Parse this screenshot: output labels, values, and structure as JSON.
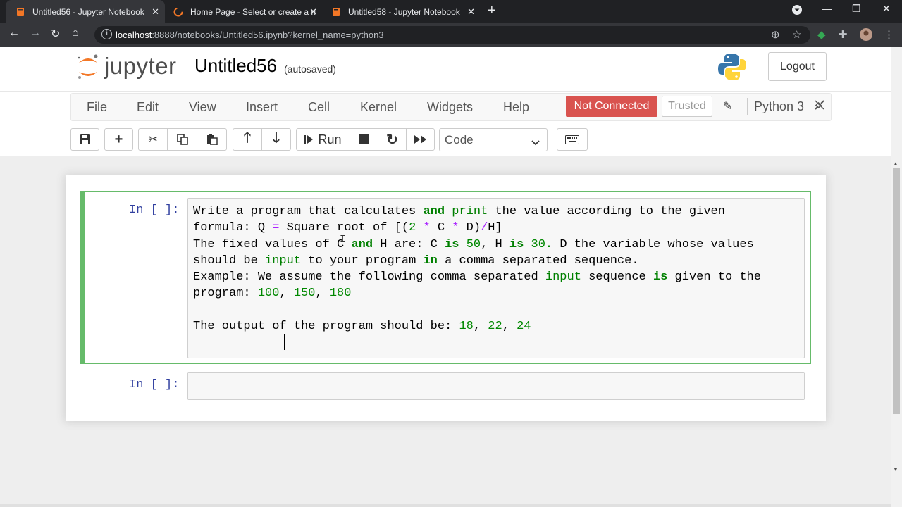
{
  "browser": {
    "tabs": [
      {
        "title": "Untitled56 - Jupyter Notebook",
        "active": true
      },
      {
        "title": "Home Page - Select or create a n",
        "active": false
      },
      {
        "title": "Untitled58 - Jupyter Notebook",
        "active": false
      }
    ],
    "url_host": "localhost",
    "url_rest": ":8888/notebooks/Untitled56.ipynb?kernel_name=python3",
    "icons": [
      "back-icon",
      "forward-icon",
      "reload-icon",
      "home-icon",
      "info-icon",
      "zoom-icon",
      "star-icon",
      "extension-icon",
      "puzzle-icon",
      "profile-icon",
      "menu-icon"
    ]
  },
  "jupyter": {
    "logo_text": "jupyter",
    "notebook_title": "Untitled56",
    "autosave": "(autosaved)",
    "logout": "Logout",
    "menu": [
      "File",
      "Edit",
      "View",
      "Insert",
      "Cell",
      "Kernel",
      "Widgets",
      "Help"
    ],
    "status": "Not Connected",
    "trusted": "Trusted",
    "kernel": "Python 3",
    "run_label": "Run",
    "cell_type": "Code",
    "colors": {
      "accent": "#66bb6a",
      "danger": "#d9534f",
      "prompt": "#303f9f"
    }
  },
  "cells": [
    {
      "prompt": "In [ ]:",
      "lines": [
        "Write a program that calculates and print the value according to the given",
        "formula: Q = Square root of [(2 * C * D)/H]",
        "The fixed values of C and H are: C is 50, H is 30. D the variable whose values",
        "should be input to your program in a comma separated sequence.",
        "Example: We assume the following comma separated input sequence is given to the",
        "program: 100, 150, 180",
        "",
        "The output of the program should be: 18, 22, 24"
      ]
    },
    {
      "prompt": "In [ ]:",
      "lines": []
    }
  ]
}
